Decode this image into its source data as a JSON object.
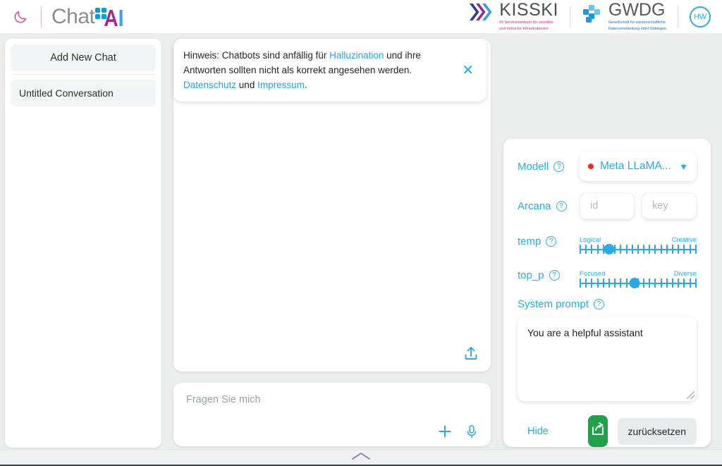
{
  "header": {
    "theme_toggle_icon": "moon-icon",
    "brand_chat": "Chat",
    "brand_ai": "AI",
    "kisski_word": "KISSKI",
    "kisski_sub_line1": "KI-Servicezentrum für sensible",
    "kisski_sub_line2": "und kritische Infrastrukturen",
    "gwdg_word": "GWDG",
    "gwdg_sub_line1": "Gesellschaft für wissenschaftliche",
    "gwdg_sub_line2": "Datenverarbeitung mbH Göttingen",
    "avatar_initials": "HW"
  },
  "sidebar": {
    "add_chat_label": "Add New Chat",
    "conversations": [
      {
        "title": "Untitled Conversation"
      }
    ]
  },
  "notice": {
    "prefix": "Hinweis: Chatbots sind anfällig für ",
    "link_halluzination": "Halluzination",
    "middle": " und ihre Antworten sollten nicht als korrekt angesehen werden. ",
    "link_datenschutz": "Datenschutz",
    "conjunction": " und ",
    "link_impressum": "Impressum",
    "suffix": ".",
    "close_icon": "close-icon"
  },
  "chat": {
    "upload_icon": "upload-icon"
  },
  "ask": {
    "placeholder": "Fragen Sie mich",
    "plus_icon": "plus-icon",
    "mic_icon": "microphone-icon"
  },
  "settings": {
    "model_label": "Modell",
    "model_value": "Meta LLaMA...",
    "model_status_color": "#ef2b2b",
    "arcana_label": "Arcana",
    "arcana_id_placeholder": "id",
    "arcana_key_placeholder": "key",
    "temp_label": "temp",
    "temp_min_label": "Logical",
    "temp_max_label": "Creative",
    "temp_value_pct": 25,
    "top_p_label": "top_p",
    "top_p_min_label": "Focused",
    "top_p_max_label": "Diverse",
    "top_p_value_pct": 47,
    "system_prompt_label": "System prompt",
    "system_prompt_value": "You are a helpful assistant",
    "hide_label": "Hide",
    "share_icon": "share-icon",
    "reset_label": "zurücksetzen",
    "help_icon": "help-icon",
    "accent_color": "#29abe2"
  },
  "bottom": {
    "collapse_icon": "chevron-up-icon"
  }
}
